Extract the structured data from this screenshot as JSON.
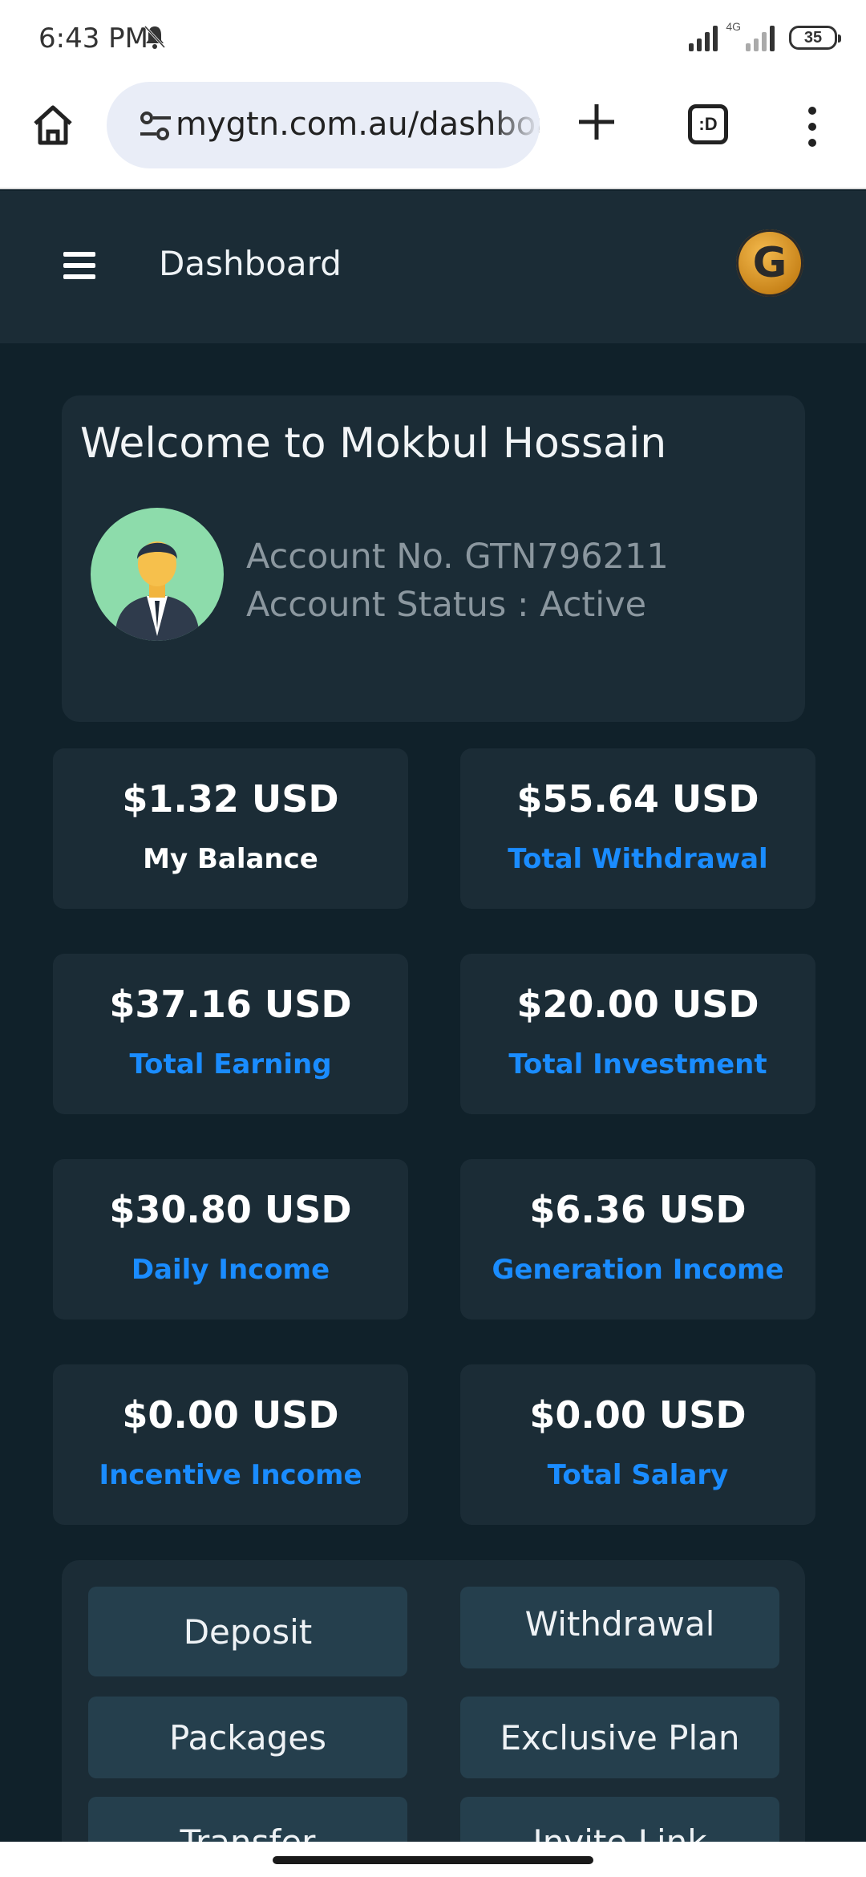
{
  "status_bar": {
    "time": "6:43 PM",
    "network_label": "4G",
    "battery": "35"
  },
  "browser": {
    "url": "mygtn.com.au/dashboard",
    "tab_switcher_label": ":D"
  },
  "header": {
    "title": "Dashboard",
    "logo_letter": "G"
  },
  "welcome": {
    "title": "Welcome to Mokbul Hossain",
    "account_no": "Account No. GTN796211",
    "account_status": "Account Status : Active"
  },
  "stats": [
    {
      "value": "$1.32 USD",
      "label": "My Balance"
    },
    {
      "value": "$55.64 USD",
      "label": "Total Withdrawal"
    },
    {
      "value": "$37.16 USD",
      "label": "Total Earning"
    },
    {
      "value": "$20.00 USD",
      "label": "Total Investment"
    },
    {
      "value": "$30.80 USD",
      "label": "Daily Income"
    },
    {
      "value": "$6.36 USD",
      "label": "Generation Income"
    },
    {
      "value": "$0.00 USD",
      "label": "Incentive Income"
    },
    {
      "value": "$0.00 USD",
      "label": "Total Salary"
    }
  ],
  "actions": [
    {
      "label": "Deposit"
    },
    {
      "label": "Withdrawal"
    },
    {
      "label": "Packages"
    },
    {
      "label": "Exclusive Plan"
    },
    {
      "label": "Transfer"
    },
    {
      "label": "Invite Link"
    }
  ],
  "colors": {
    "background": "#10212a",
    "card": "#1b2c36",
    "accent": "#1a8cff",
    "button": "#253f4d"
  }
}
